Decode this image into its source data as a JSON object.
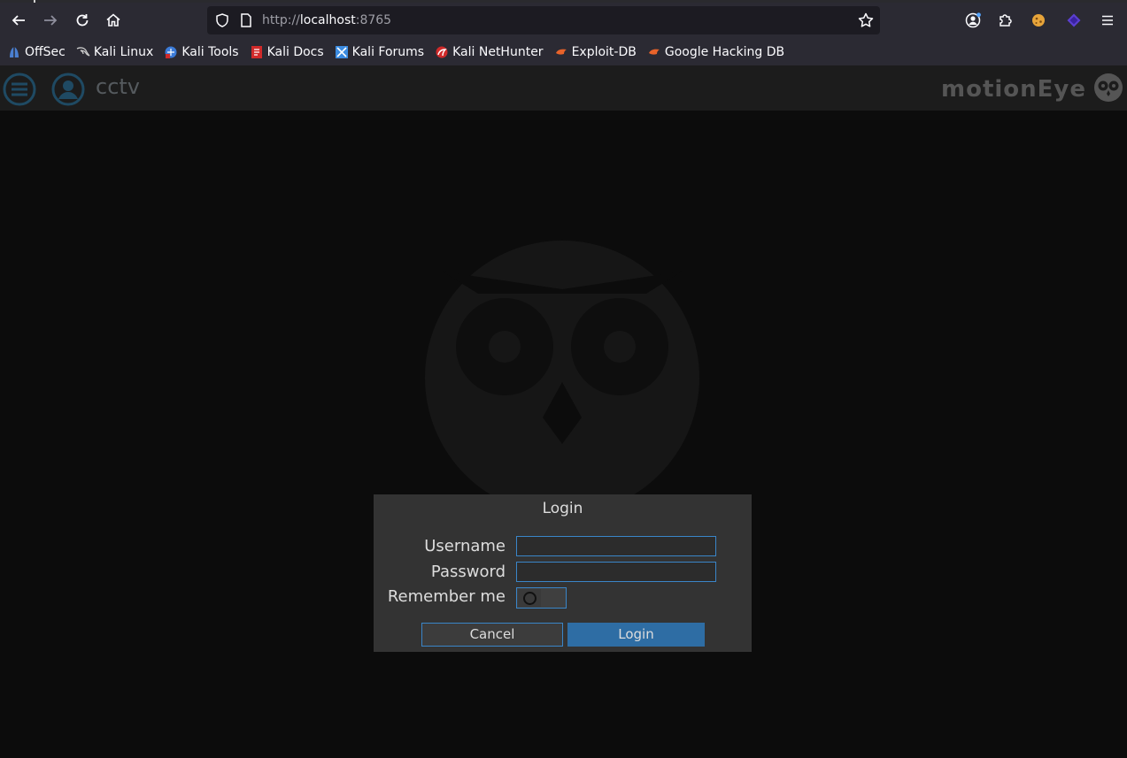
{
  "browser": {
    "url_scheme": "http://",
    "url_host": "localhost",
    "url_port": ":8765",
    "bookmarks": [
      {
        "label": "OffSec",
        "icon": "offsec-icon",
        "color": "#4a7fd0"
      },
      {
        "label": "Kali Linux",
        "icon": "kali-dragon-icon",
        "color": "#cccccc"
      },
      {
        "label": "Kali Tools",
        "icon": "kali-tools-icon",
        "color": "#3b7bd8"
      },
      {
        "label": "Kali Docs",
        "icon": "kali-docs-icon",
        "color": "#d02a2a"
      },
      {
        "label": "Kali Forums",
        "icon": "kali-forums-icon",
        "color": "#3b8be0"
      },
      {
        "label": "Kali NetHunter",
        "icon": "nethunter-icon",
        "color": "#d02a2a"
      },
      {
        "label": "Exploit-DB",
        "icon": "exploit-db-icon",
        "color": "#e8632a"
      },
      {
        "label": "Google Hacking DB",
        "icon": "ghdb-icon",
        "color": "#e8632a"
      }
    ]
  },
  "header": {
    "title": "cctv",
    "brand": "motionEye"
  },
  "login": {
    "title": "Login",
    "username_label": "Username",
    "password_label": "Password",
    "remember_label": "Remember me",
    "username_value": "",
    "password_value": "",
    "remember_on": false,
    "cancel_label": "Cancel",
    "login_label": "Login"
  },
  "colors": {
    "accent": "#3a85c8",
    "login_button": "#2e6da4",
    "header_icon": "#1f4a63"
  }
}
